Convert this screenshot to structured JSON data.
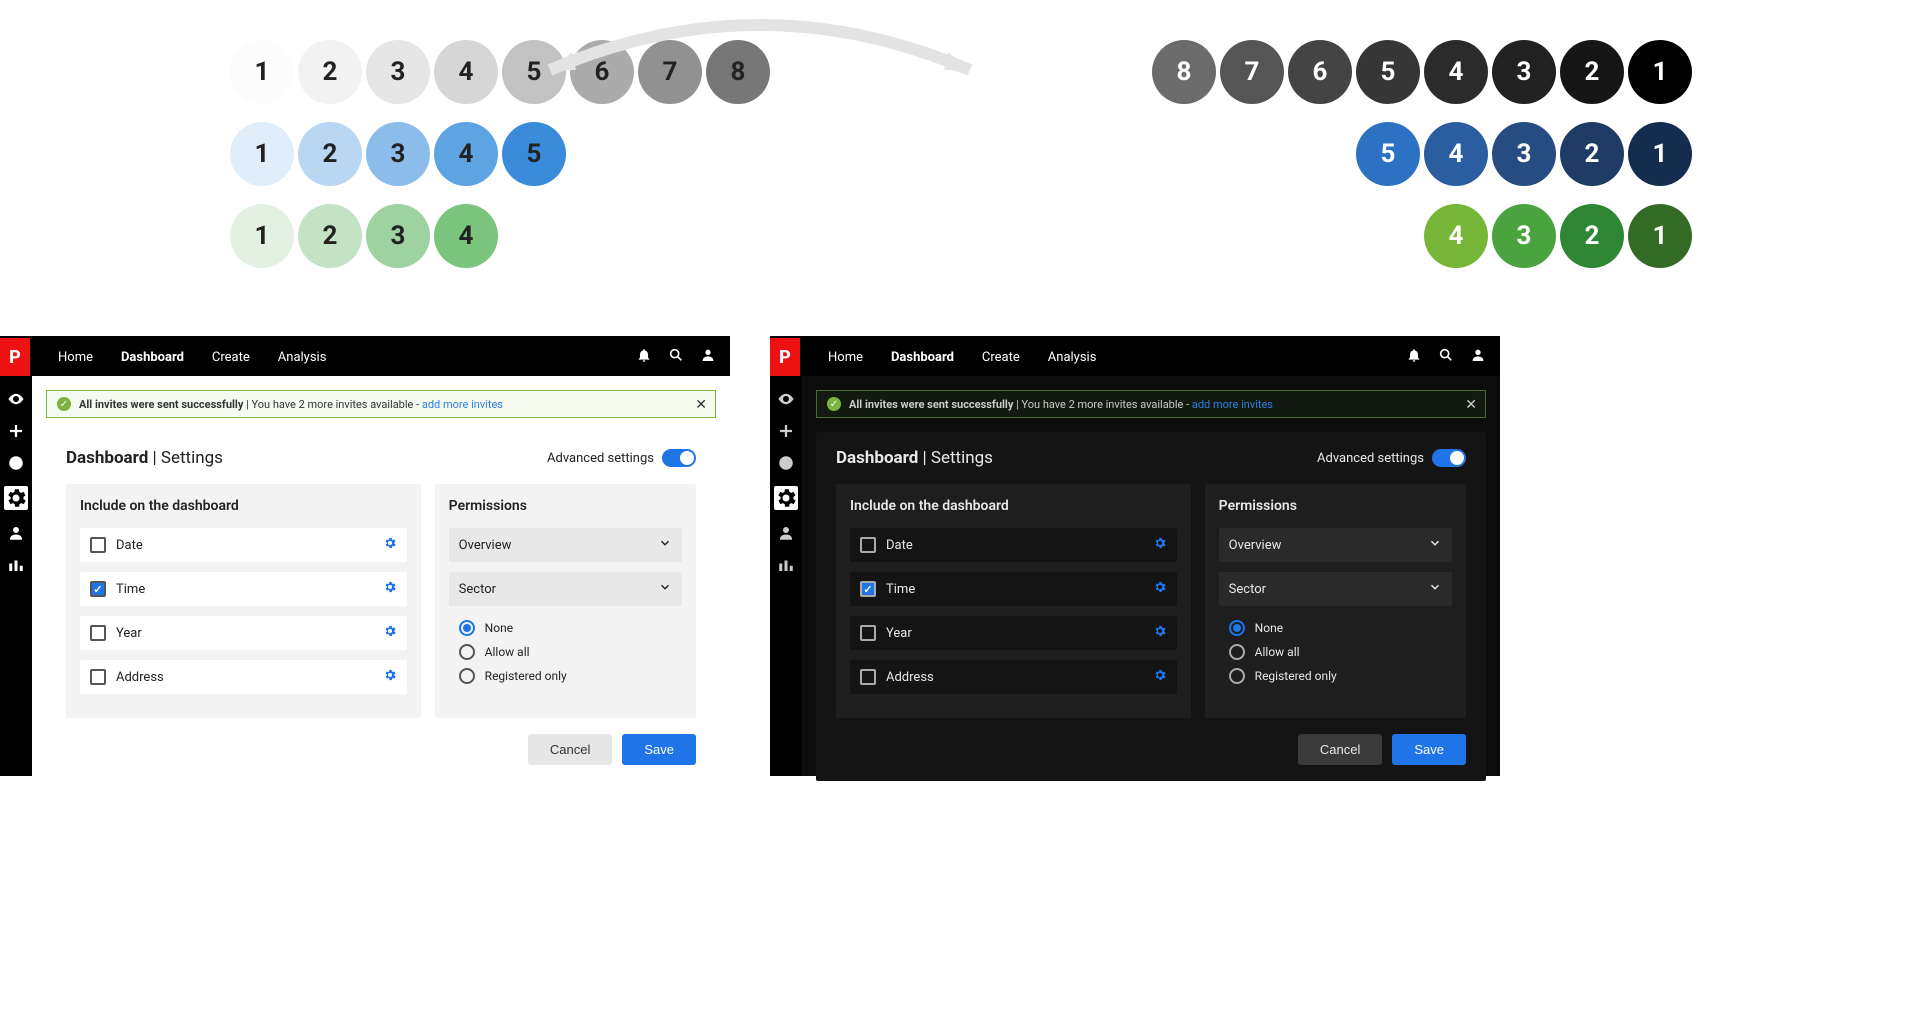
{
  "palette": {
    "gray_light": [
      {
        "n": "1",
        "c": "#fcfcfc"
      },
      {
        "n": "2",
        "c": "#f2f2f2"
      },
      {
        "n": "3",
        "c": "#e6e6e6"
      },
      {
        "n": "4",
        "c": "#d6d6d6"
      },
      {
        "n": "5",
        "c": "#c2c2c2"
      },
      {
        "n": "6",
        "c": "#ababab"
      },
      {
        "n": "7",
        "c": "#919191"
      },
      {
        "n": "8",
        "c": "#777777"
      }
    ],
    "gray_dark": [
      {
        "n": "8",
        "c": "#6b6b6b"
      },
      {
        "n": "7",
        "c": "#555555"
      },
      {
        "n": "6",
        "c": "#444444"
      },
      {
        "n": "5",
        "c": "#363636"
      },
      {
        "n": "4",
        "c": "#2b2b2b"
      },
      {
        "n": "3",
        "c": "#212121"
      },
      {
        "n": "2",
        "c": "#151515"
      },
      {
        "n": "1",
        "c": "#000000"
      }
    ],
    "blue_light": [
      {
        "n": "1",
        "c": "#e1edf9"
      },
      {
        "n": "2",
        "c": "#b9d6f2"
      },
      {
        "n": "3",
        "c": "#8cbdea"
      },
      {
        "n": "4",
        "c": "#5ea3e2"
      },
      {
        "n": "5",
        "c": "#3b8bdb"
      }
    ],
    "blue_dark": [
      {
        "n": "5",
        "c": "#2d72c2"
      },
      {
        "n": "4",
        "c": "#2b5da1"
      },
      {
        "n": "3",
        "c": "#274c81"
      },
      {
        "n": "2",
        "c": "#1f3c66"
      },
      {
        "n": "1",
        "c": "#142c4d"
      }
    ],
    "green_light": [
      {
        "n": "1",
        "c": "#e3f1e3"
      },
      {
        "n": "2",
        "c": "#c3e3c4"
      },
      {
        "n": "3",
        "c": "#9fd2a1"
      },
      {
        "n": "4",
        "c": "#7ac47e"
      }
    ],
    "green_dark": [
      {
        "n": "4",
        "c": "#78b63a"
      },
      {
        "n": "3",
        "c": "#4aa33f"
      },
      {
        "n": "2",
        "c": "#2f8735"
      },
      {
        "n": "1",
        "c": "#336b25"
      }
    ]
  },
  "nav": {
    "items": [
      "Home",
      "Dashboard",
      "Create",
      "Analysis"
    ],
    "active": "Dashboard"
  },
  "alert": {
    "strong": "All invites were sent successfully",
    "text": "You have 2 more invites available -",
    "link": "add more invites"
  },
  "panel": {
    "title_bold": "Dashboard",
    "title_sep": " | ",
    "title_rest": "Settings",
    "advanced_label": "Advanced settings"
  },
  "include": {
    "heading": "Include on the dashboard",
    "items": [
      {
        "label": "Date",
        "checked": false
      },
      {
        "label": "Time",
        "checked": true
      },
      {
        "label": "Year",
        "checked": false
      },
      {
        "label": "Address",
        "checked": false
      }
    ]
  },
  "perm": {
    "heading": "Permissions",
    "dropdowns": [
      "Overview",
      "Sector"
    ],
    "radios": [
      {
        "label": "None",
        "selected": true
      },
      {
        "label": "Allow all",
        "selected": false
      },
      {
        "label": "Registered only",
        "selected": false
      }
    ]
  },
  "buttons": {
    "cancel": "Cancel",
    "save": "Save"
  }
}
